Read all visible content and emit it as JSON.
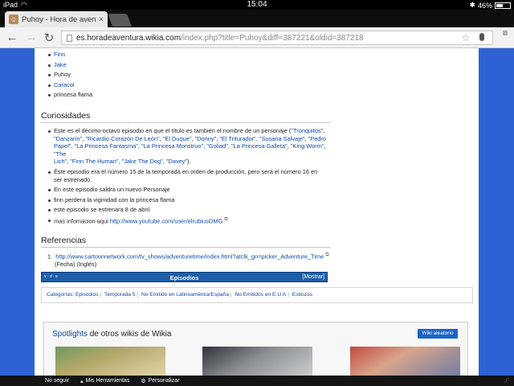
{
  "status_bar": {
    "device": "iPad",
    "time": "15:04",
    "battery": "46%",
    "battery_level": 0.46
  },
  "tab": {
    "title": "Puhoy - Hora de aventura",
    "close": "×"
  },
  "address": {
    "host": "es.horadeaventura.wikia.com",
    "path": "/index.php?title=Puhoy&diff=387221&oldid=387218"
  },
  "characters": [
    "Finn",
    "Jake",
    "Puhoy",
    "Caracol",
    "princesa flama"
  ],
  "curiosidades": {
    "heading": "Curiosidades",
    "intro": "Este es el décimo-octavo episodio en que el título es también el nombre de un personaje (",
    "links_line1": [
      "\"Tronquitos\""
    ],
    "links_line2": [
      "\"Danzarín\"",
      "\"Ricardio Corazón De León\"",
      "\"El Duque\"",
      "\"Donny\"",
      "\"El Triturador\"",
      "\"Susana Salvaje\"",
      "\"Pedro"
    ],
    "links_line3": [
      "Papel\"",
      "\"La Princesa Fantasma\"",
      "\"La Princesa Monstruo\"",
      "\"Goliad\"",
      "\"La Princesa Galleta\"",
      "\"King Worm\"",
      "\"The"
    ],
    "links_line4": [
      "Lich\"",
      "\"Finn The Human\"",
      "\"Jake The Dog\"",
      "\"Davey\""
    ],
    "closing": ").",
    "item2": "Éste episodio era el número 15 de la temporada en orden de producción, pero será el número 16 en ser estrenado.",
    "item3": "En este episodio saldra un nuevo Personaje",
    "item4": "finn perdera la viginidad con la princesa flama",
    "item5": "este episodio se estrenara 8 de abril",
    "item6_text": "mas infomacion aqui ",
    "item6_link": "http://www.youtube.com/user/elrubiusOMG"
  },
  "referencias": {
    "heading": "Referencias",
    "num": "1.",
    "link": "http://www.cartoonnetwork.com/tv_shows/adventuretime/index.html?atclk_gn=picker_Adventure_Time",
    "note": "(Fecha) (Inglés)"
  },
  "navbox": {
    "vde": "v · d · e",
    "title": "Episodios",
    "show": "[Mostrar]"
  },
  "categories": {
    "label": "Categorías:",
    "items": [
      "Episodios",
      "Temporada 5",
      "No Emitido en Latinoamérica/España",
      "No Emitidos en E.U.A",
      "Esbozos"
    ]
  },
  "spotlights": {
    "title_link": "Spotlights",
    "title_rest": " de otros wikis de Wikia",
    "button": "Wiki aleatorio"
  },
  "wiki_toolbar": {
    "follow": "No seguir",
    "tools": "Mis Herramientas",
    "customize": "Personalizar"
  }
}
